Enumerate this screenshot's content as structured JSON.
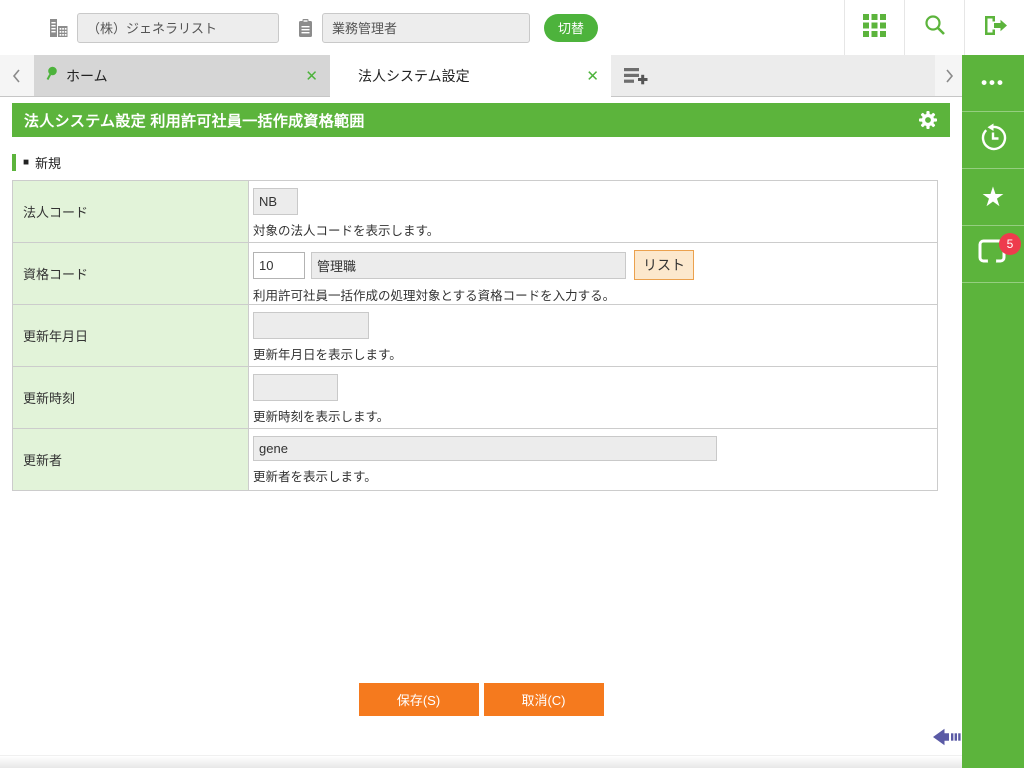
{
  "topbar": {
    "company": {
      "value": "（株）ジェネラリスト"
    },
    "role": {
      "value": "業務管理者"
    },
    "switch_label": "切替"
  },
  "tabbar": {
    "home_tab_label": "ホーム",
    "active_tab_label": "法人システム設定",
    "close_glyph": "✕"
  },
  "page": {
    "title": "法人システム設定 利用許可社員一括作成資格範囲",
    "section_marker": "■",
    "section_title": "新規"
  },
  "form": {
    "rows": [
      {
        "label": "法人コード",
        "value": "NB",
        "hint": "対象の法人コードを表示します。"
      },
      {
        "label": "資格コード",
        "code": "10",
        "name": "管理職",
        "list_button": "リスト",
        "hint": "利用許可社員一括作成の処理対象とする資格コードを入力する。"
      },
      {
        "label": "更新年月日",
        "value": "",
        "hint": "更新年月日を表示します。"
      },
      {
        "label": "更新時刻",
        "value": "",
        "hint": "更新時刻を表示します。"
      },
      {
        "label": "更新者",
        "value": "gene",
        "hint": "更新者を表示します。"
      }
    ]
  },
  "actions": {
    "save": "保存(S)",
    "cancel": "取消(C)"
  },
  "sidebar": {
    "notification_count": "5"
  },
  "colors": {
    "brand_green": "#5cb43c",
    "label_cell_green": "#e2f3d9",
    "accent_orange": "#f57a1e",
    "list_button_bg": "#fce8cd",
    "list_button_border": "#eba14e",
    "badge_red": "#ee3b4d",
    "collapse_arrow_indigo": "#5a5aa5"
  }
}
